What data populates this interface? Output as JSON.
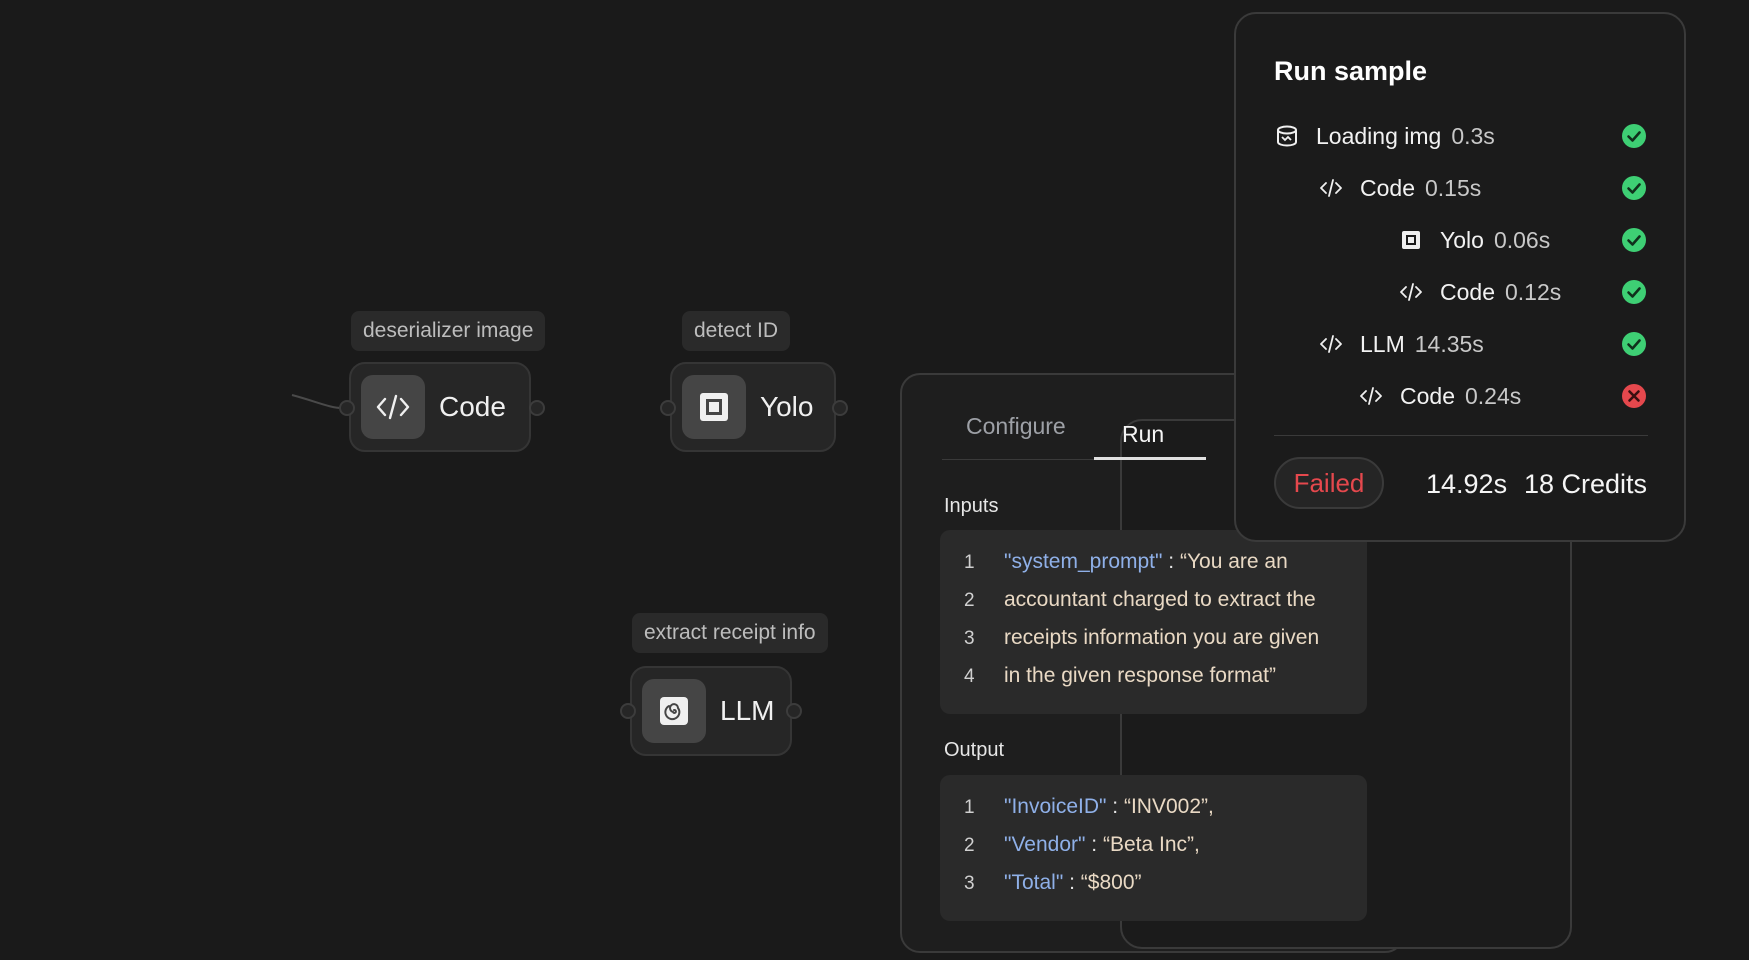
{
  "canvas": {
    "nodes": [
      {
        "tag": "deserializer image",
        "label": "Code",
        "icon": "code-icon"
      },
      {
        "tag": "detect ID",
        "label": "Yolo",
        "icon": "object-detect-icon"
      },
      {
        "tag": "extract receipt info",
        "label": "LLM",
        "icon": "llm-spiral-icon"
      }
    ]
  },
  "panel": {
    "tabs": {
      "configure": "Configure",
      "run": "Run",
      "active": "Run"
    },
    "inputs_title": "Inputs",
    "inputs": [
      {
        "num": "1",
        "key": "\"system_prompt\"",
        "sep": " : ",
        "text": "“You are an"
      },
      {
        "num": "2",
        "text": "accountant charged to extract the"
      },
      {
        "num": "3",
        "text": "receipts information you are given"
      },
      {
        "num": "4",
        "text": "in the given response format”"
      }
    ],
    "output_title": "Output",
    "outputs": [
      {
        "num": "1",
        "key": "\"InvoiceID\"",
        "sep": " : ",
        "text": "“INV002”,"
      },
      {
        "num": "2",
        "key": "\"Vendor\"",
        "sep": " : ",
        "text": "“Beta Inc”,"
      },
      {
        "num": "3",
        "key": "\"Total\"",
        "sep": " : ",
        "text": "“$800”"
      }
    ]
  },
  "run_sample": {
    "title": "Run sample",
    "steps": [
      {
        "name": "Loading img",
        "time": "0.3s",
        "icon": "database-icon",
        "status": "success"
      },
      {
        "name": "Code",
        "time": "0.15s",
        "icon": "code-icon",
        "status": "success"
      },
      {
        "name": "Yolo",
        "time": "0.06s",
        "icon": "object-detect-icon",
        "status": "success"
      },
      {
        "name": "Code",
        "time": "0.12s",
        "icon": "code-icon",
        "status": "success"
      },
      {
        "name": "LLM",
        "time": "14.35s",
        "icon": "code-icon",
        "status": "success"
      },
      {
        "name": "Code",
        "time": "0.24s",
        "icon": "code-icon",
        "status": "error"
      }
    ],
    "result": "Failed",
    "duration": "14.92s",
    "credits": "18 Credits"
  },
  "colors": {
    "success": "#3ecf74",
    "error": "#e5484d",
    "accent_wire": "#d08a2a",
    "key": "#8fb0e8"
  }
}
